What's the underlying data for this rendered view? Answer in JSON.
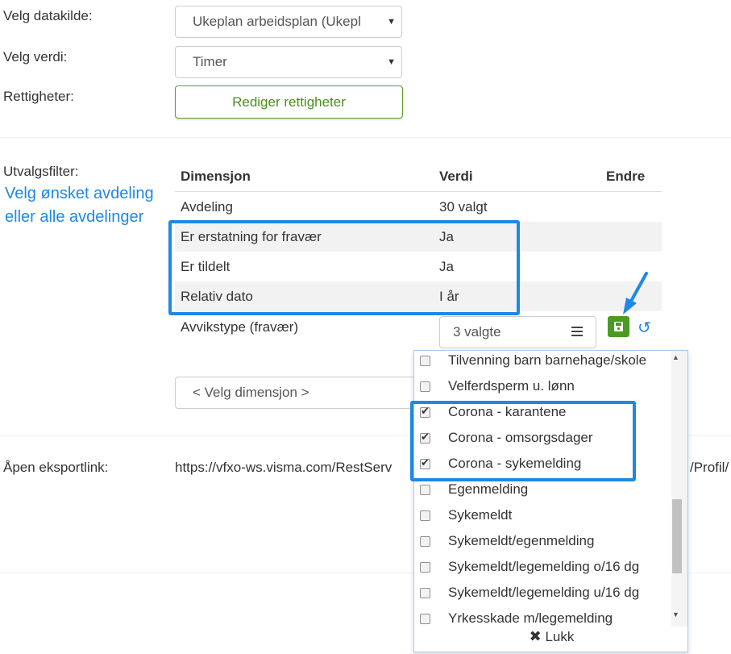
{
  "form": {
    "datakilde_label": "Velg datakilde:",
    "datakilde_value": "Ukeplan arbeidsplan (Ukepl",
    "verdi_label": "Velg verdi:",
    "verdi_value": "Timer",
    "rettigheter_label": "Rettigheter:",
    "rettigheter_button": "Rediger rettigheter",
    "utvalgsfilter_label": "Utvalgsfilter:"
  },
  "annotation": {
    "line1": "Velg ønsket avdeling",
    "line2": "eller alle avdelinger"
  },
  "table": {
    "headers": [
      "Dimensjon",
      "Verdi",
      "Endre"
    ],
    "rows": [
      {
        "dim": "Avdeling",
        "val": "30 valgt"
      },
      {
        "dim": "Er erstatning for fravær",
        "val": "Ja"
      },
      {
        "dim": "Er tildelt",
        "val": "Ja"
      },
      {
        "dim": "Relativ dato",
        "val": "I år"
      }
    ],
    "edit_row": {
      "dim": "Avvikstype (fravær)",
      "multiselect_value": "3 valgte"
    }
  },
  "velg_dimensjon": "< Velg dimensjon >",
  "export": {
    "label": "Åpen eksportlink:",
    "url_start": "https://vfxo-ws.visma.com/RestServ",
    "url_end": "/Profil/"
  },
  "dropdown": {
    "options": [
      {
        "label": "Tilvenning barn barnehage/skole",
        "checked": false
      },
      {
        "label": "Velferdsperm u. lønn",
        "checked": false
      },
      {
        "label": "Corona - karantene",
        "checked": true
      },
      {
        "label": "Corona - omsorgsdager",
        "checked": true
      },
      {
        "label": "Corona - sykemelding",
        "checked": true
      },
      {
        "label": "Egenmelding",
        "checked": false
      },
      {
        "label": "Sykemeldt",
        "checked": false
      },
      {
        "label": "Sykemeldt/egenmelding",
        "checked": false
      },
      {
        "label": "Sykemeldt/legemelding o/16 dg",
        "checked": false
      },
      {
        "label": "Sykemeldt/legemelding u/16 dg",
        "checked": false
      },
      {
        "label": "Yrkesskade m/legemelding",
        "checked": false
      }
    ],
    "close_label": "Lukk"
  },
  "colors": {
    "accent_blue": "#1e88e5",
    "green": "#4b9a22",
    "row_alt": "#f2f2f2"
  }
}
